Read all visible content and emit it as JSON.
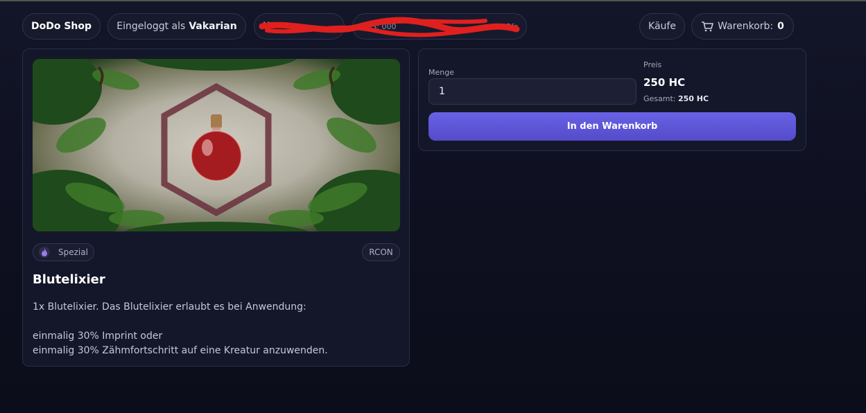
{
  "header": {
    "brand": "DoDo Shop",
    "login_prefix": "Eingeloggt als",
    "username": "Vakarian",
    "redacted_1_visible": "H",
    "redacted_2_visible_start": "POS: 000",
    "redacted_2_visible_end": "12fc",
    "purchases_label": "Käufe",
    "cart_label": "Warenkorb:",
    "cart_count": "0",
    "cart_icon": "shopping-cart-icon"
  },
  "product": {
    "badge_category": "Spezial",
    "badge_category_icon": "flame-icon",
    "badge_delivery": "RCON",
    "title": "Blutelixier",
    "description": "1x Blutelixier. Das Blutelixier erlaubt es bei Anwendung:\n\neinmalig 30% Imprint oder\neinmalig 30% Zähmfortschritt auf eine Kreatur anzuwenden."
  },
  "purchase": {
    "quantity_label": "Menge",
    "quantity_value": "1",
    "price_label": "Preis",
    "price_value": "250 HC",
    "total_label": "Gesamt:",
    "total_value": "250 HC",
    "add_to_cart_label": "In den Warenkorb"
  },
  "colors": {
    "background": "#0f1122",
    "card": "#141729",
    "accent": "#5b54d8",
    "redaction": "#e0201f"
  }
}
